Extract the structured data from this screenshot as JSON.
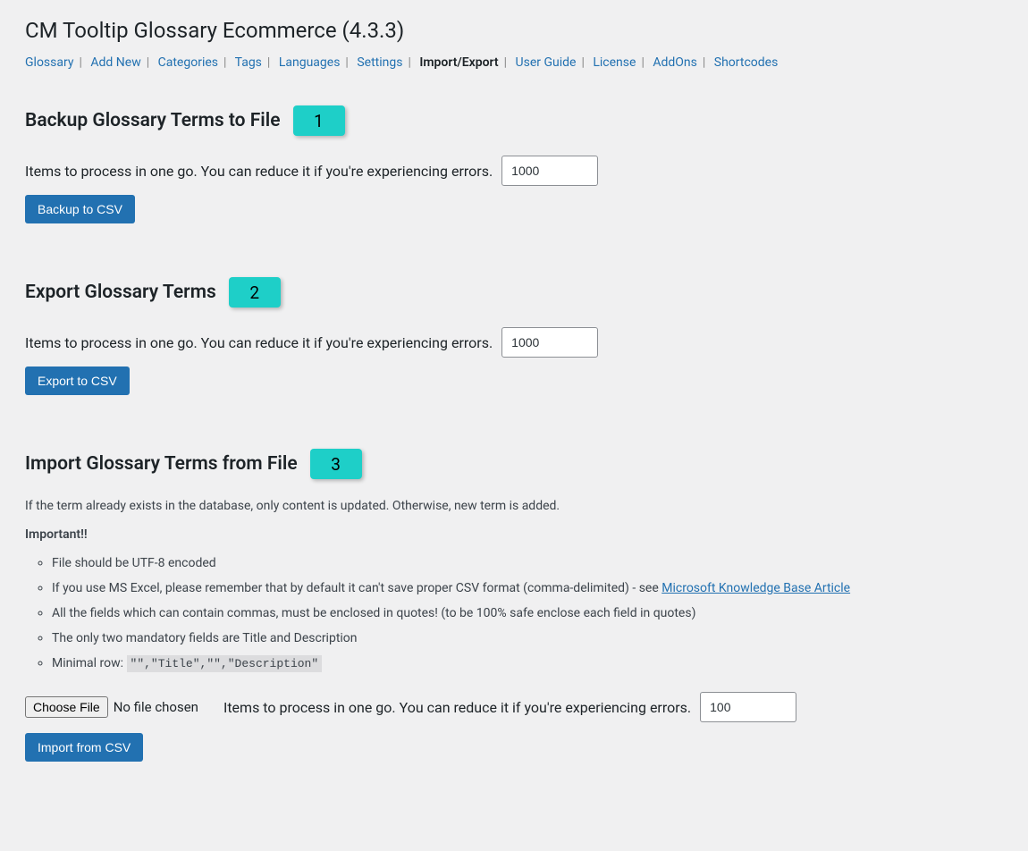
{
  "page_title": "CM Tooltip Glossary Ecommerce (4.3.3)",
  "tabs": {
    "glossary": "Glossary",
    "add_new": "Add New",
    "categories": "Categories",
    "tags": "Tags",
    "languages": "Languages",
    "settings": "Settings",
    "import_export": "Import/Export",
    "user_guide": "User Guide",
    "license": "License",
    "addons": "AddOns",
    "shortcodes": "Shortcodes"
  },
  "backup": {
    "heading": "Backup Glossary Terms to File",
    "badge": "1",
    "items_label": "Items to process in one go. You can reduce it if you're experiencing errors.",
    "items_value": "1000",
    "button": "Backup to CSV"
  },
  "export": {
    "heading": "Export Glossary Terms",
    "badge": "2",
    "items_label": "Items to process in one go. You can reduce it if you're experiencing errors.",
    "items_value": "1000",
    "button": "Export to CSV"
  },
  "import": {
    "heading": "Import Glossary Terms from File",
    "badge": "3",
    "intro": "If the term already exists in the database, only content is updated. Otherwise, new term is added.",
    "important_label": "Important!!",
    "notes": {
      "note1": "File should be UTF-8 encoded",
      "note2a": "If you use MS Excel, please remember that by default it can't save proper CSV format (comma-delimited) - see ",
      "note2_link": "Microsoft Knowledge Base Article",
      "note3": "All the fields which can contain commas, must be enclosed in quotes! (to be 100% safe enclose each field in quotes)",
      "note4": "The only two mandatory fields are Title and Description",
      "note5a": "Minimal row: ",
      "note5_code": "\"\",\"Title\",\"\",\"Description\""
    },
    "choose_file_btn": "Choose File",
    "no_file": "No file chosen",
    "items_label": "Items to process in one go. You can reduce it if you're experiencing errors.",
    "items_value": "100",
    "button": "Import from CSV"
  }
}
